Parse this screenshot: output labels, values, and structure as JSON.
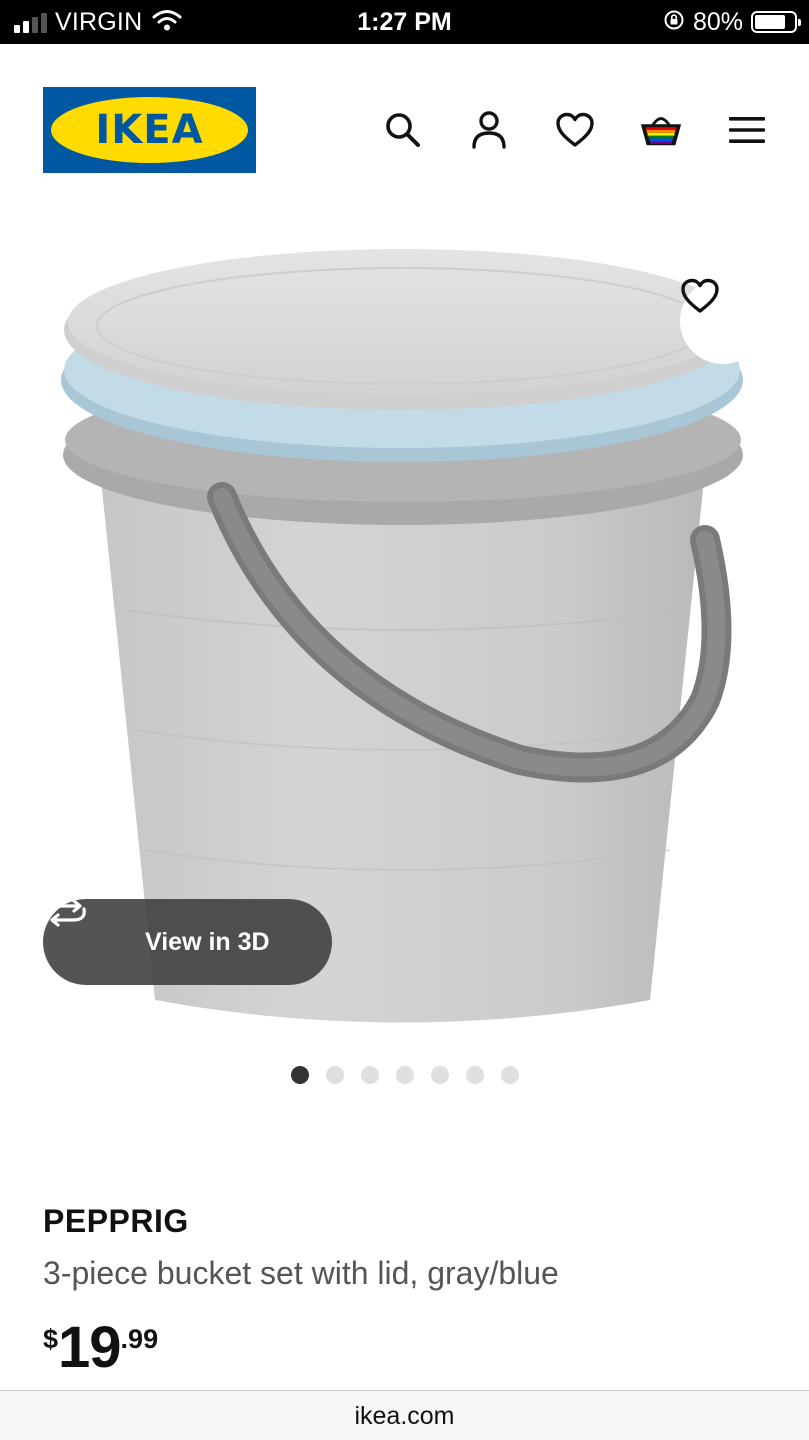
{
  "status_bar": {
    "carrier": "VIRGIN",
    "time": "1:27 PM",
    "battery_percent": "80%",
    "battery_level": 0.8,
    "signal_bars_active": 2,
    "signal_bars_total": 4
  },
  "header": {
    "logo_text": "IKEA",
    "icons": [
      "search-icon",
      "account-icon",
      "favorites-icon",
      "cart-icon",
      "menu-icon"
    ],
    "brand_blue": "#0058a3",
    "brand_yellow": "#ffdb00"
  },
  "gallery": {
    "view_3d_label": "View in 3D",
    "total_images": 7,
    "active_index": 0
  },
  "product": {
    "name": "PEPPRIG",
    "description": "3-piece bucket set with lid, gray/blue",
    "price_currency": "$",
    "price_integer": "19",
    "price_decimal": ".99"
  },
  "browser": {
    "url": "ikea.com"
  }
}
